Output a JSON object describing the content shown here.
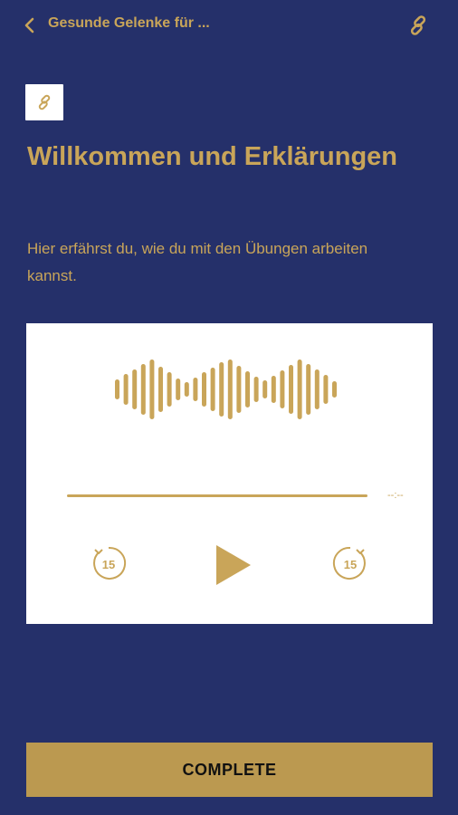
{
  "header": {
    "title": "Gesunde Gelenke für ...",
    "back_icon": "chevron-left-icon",
    "share_icon": "link-icon"
  },
  "content": {
    "type_icon": "link-icon",
    "title": "Willkommen und Erklärungen",
    "description": "Hier erfährst du, wie du mit den Übungen arbeiten kannst."
  },
  "player": {
    "time": "--:--",
    "rewind_seconds": "15",
    "forward_seconds": "15",
    "play_icon": "play-icon",
    "waveform_icon": "audio-waveform-icon"
  },
  "actions": {
    "complete_label": "COMPLETE"
  },
  "colors": {
    "background": "#25306a",
    "accent": "#c9a559",
    "button": "#bb9950",
    "card": "#ffffff"
  }
}
